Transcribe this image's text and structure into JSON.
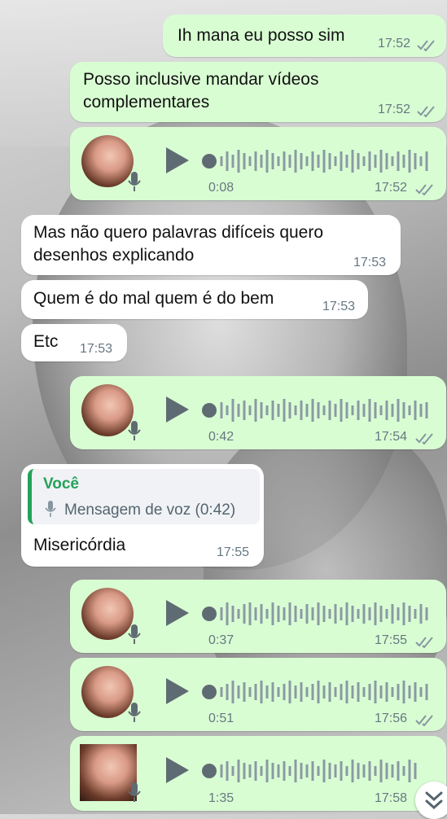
{
  "messages": [
    {
      "type": "text",
      "dir": "out",
      "text": "Ih mana eu posso sim",
      "time": "17:52"
    },
    {
      "type": "text",
      "dir": "out",
      "text_lines": [
        "Posso inclusive mandar vídeos",
        "complementares"
      ],
      "time": "17:52"
    },
    {
      "type": "voice",
      "dir": "out",
      "duration": "0:08",
      "time": "17:52"
    },
    {
      "type": "text",
      "dir": "in",
      "text_lines": [
        "Mas não quero palavras difíceis quero",
        "desenhos explicando"
      ],
      "time": "17:53"
    },
    {
      "type": "text",
      "dir": "in",
      "text": "Quem é do mal quem é do bem",
      "time": "17:53"
    },
    {
      "type": "text",
      "dir": "in",
      "text": "Etc",
      "time": "17:53"
    },
    {
      "type": "voice",
      "dir": "out",
      "duration": "0:42",
      "time": "17:54"
    },
    {
      "type": "reply",
      "dir": "in",
      "quote_author": "Você",
      "quote_text": "Mensagem de voz (0:42)",
      "text": "Misericórdia",
      "time": "17:55"
    },
    {
      "type": "voice",
      "dir": "out",
      "duration": "0:37",
      "time": "17:55"
    },
    {
      "type": "voice",
      "dir": "out",
      "duration": "0:51",
      "time": "17:56"
    },
    {
      "type": "voice",
      "dir": "out",
      "duration": "1:35",
      "time": "17:58"
    }
  ],
  "colors": {
    "outgoing_bubble": "#d9fdd3",
    "incoming_bubble": "#ffffff",
    "reply_accent": "#25a15a",
    "ticks": "#8696a0"
  },
  "icons": {
    "read_receipt": "double-check-icon",
    "play": "play-icon",
    "mic": "mic-icon",
    "scroll": "chevron-double-down-icon"
  }
}
